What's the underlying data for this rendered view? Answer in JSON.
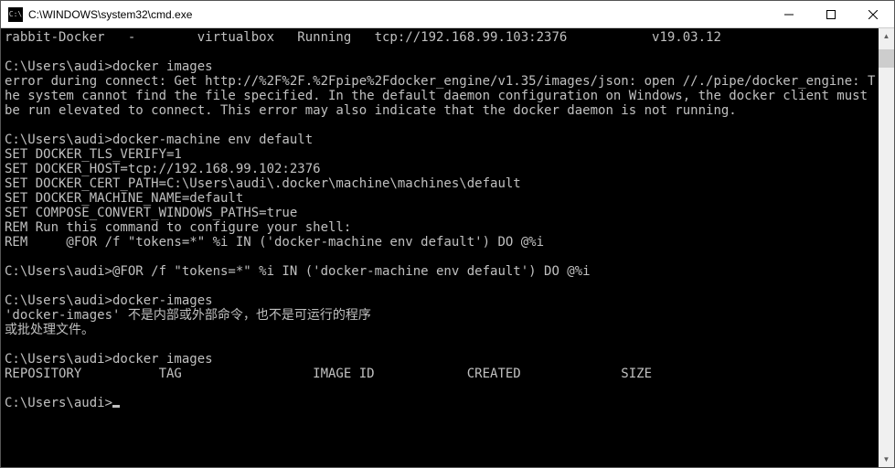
{
  "window": {
    "title": "C:\\WINDOWS\\system32\\cmd.exe",
    "icon_label": "C:\\"
  },
  "lines": [
    "rabbit-Docker   -        virtualbox   Running   tcp://192.168.99.103:2376           v19.03.12",
    "",
    "C:\\Users\\audi>docker images",
    "error during connect: Get http://%2F%2F.%2Fpipe%2Fdocker_engine/v1.35/images/json: open //./pipe/docker_engine: The system cannot find the file specified. In the default daemon configuration on Windows, the docker client must be run elevated to connect. This error may also indicate that the docker daemon is not running.",
    "",
    "C:\\Users\\audi>docker-machine env default",
    "SET DOCKER_TLS_VERIFY=1",
    "SET DOCKER_HOST=tcp://192.168.99.102:2376",
    "SET DOCKER_CERT_PATH=C:\\Users\\audi\\.docker\\machine\\machines\\default",
    "SET DOCKER_MACHINE_NAME=default",
    "SET COMPOSE_CONVERT_WINDOWS_PATHS=true",
    "REM Run this command to configure your shell:",
    "REM     @FOR /f \"tokens=*\" %i IN ('docker-machine env default') DO @%i",
    "",
    "C:\\Users\\audi>@FOR /f \"tokens=*\" %i IN ('docker-machine env default') DO @%i",
    "",
    "C:\\Users\\audi>docker-images",
    "'docker-images' 不是内部或外部命令，也不是可运行的程序",
    "或批处理文件。",
    "",
    "C:\\Users\\audi>docker images",
    "REPOSITORY          TAG                 IMAGE ID            CREATED             SIZE",
    "",
    "C:\\Users\\audi>"
  ]
}
